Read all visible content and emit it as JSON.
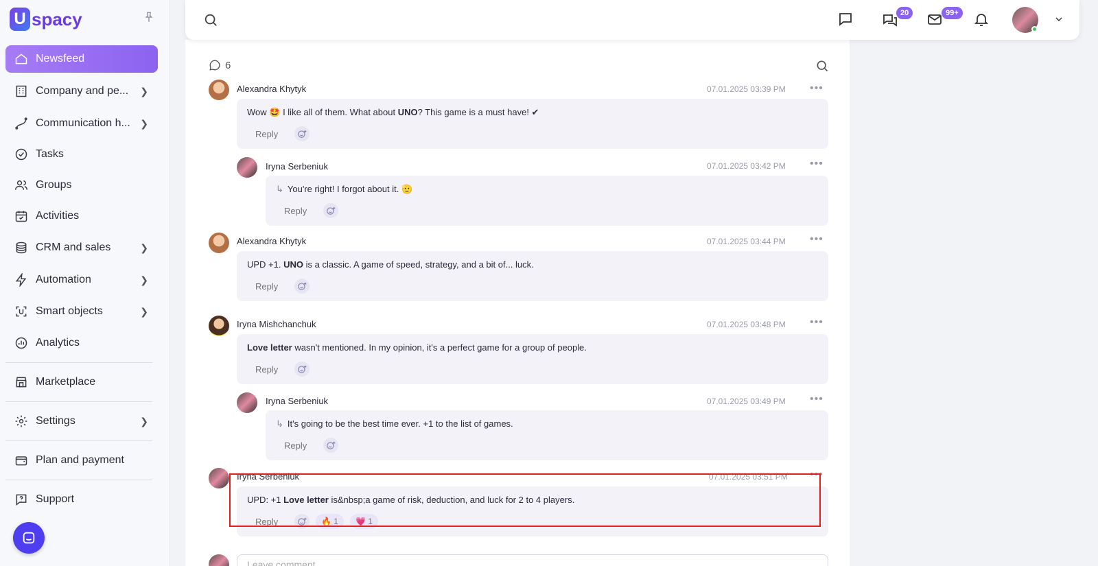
{
  "brand": {
    "logo_letter": "U",
    "logo_text": "spacy"
  },
  "sidebar": {
    "items": [
      {
        "label": "Newsfeed"
      },
      {
        "label": "Company and pe..."
      },
      {
        "label": "Communication h..."
      },
      {
        "label": "Tasks"
      },
      {
        "label": "Groups"
      },
      {
        "label": "Activities"
      },
      {
        "label": "CRM and sales"
      },
      {
        "label": "Automation"
      },
      {
        "label": "Smart objects"
      },
      {
        "label": "Analytics"
      },
      {
        "label": "Marketplace"
      },
      {
        "label": "Settings"
      },
      {
        "label": "Plan and payment"
      },
      {
        "label": "Support"
      }
    ]
  },
  "topbar": {
    "chat_badge": "20",
    "mail_badge": "99+"
  },
  "feed": {
    "comment_count": "6",
    "comments": [
      {
        "author": "Alexandra Khytyk",
        "time": "07.01.2025 03:39 PM",
        "text_pre": "Wow 🤩 I like all of them. What about ",
        "text_bold": "UNO",
        "text_post": "? This game is a must have! ✔",
        "reply": "Reply"
      },
      {
        "author": "Iryna Serbeniuk",
        "time": "07.01.2025 03:42 PM",
        "text": "You're right! I forgot about it. 🫡",
        "reply": "Reply"
      },
      {
        "author": "Alexandra Khytyk",
        "time": "07.01.2025 03:44 PM",
        "text_pre": "UPD +1. ",
        "text_bold": "UNO",
        "text_post": " is a classic. A game of speed, strategy, and a bit of... luck.",
        "reply": "Reply"
      },
      {
        "author": "Iryna Mishchanchuk",
        "time": "07.01.2025 03:48 PM",
        "text_bold": "Love letter",
        "text_post": " wasn't mentioned. In my opinion, it's a perfect game for a group of people.",
        "reply": "Reply"
      },
      {
        "author": "Iryna Serbeniuk",
        "time": "07.01.2025 03:49 PM",
        "text": "It's going to be the best time ever. +1 to the list of games.",
        "reply": "Reply"
      },
      {
        "author": "Iryna Serbeniuk",
        "time": "07.01.2025 03:51 PM",
        "text_pre": "UPD: +1 ",
        "text_bold": "Love letter",
        "text_post": " is&nbsp;a game of risk, deduction, and luck for 2 to 4 players.",
        "reply": "Reply",
        "reaction1": "🔥 1",
        "reaction2": "💗 1"
      }
    ],
    "leave_comment_placeholder": "Leave comment"
  },
  "colors": {
    "accent": "#8b63f0",
    "highlight_border": "#e02020"
  }
}
